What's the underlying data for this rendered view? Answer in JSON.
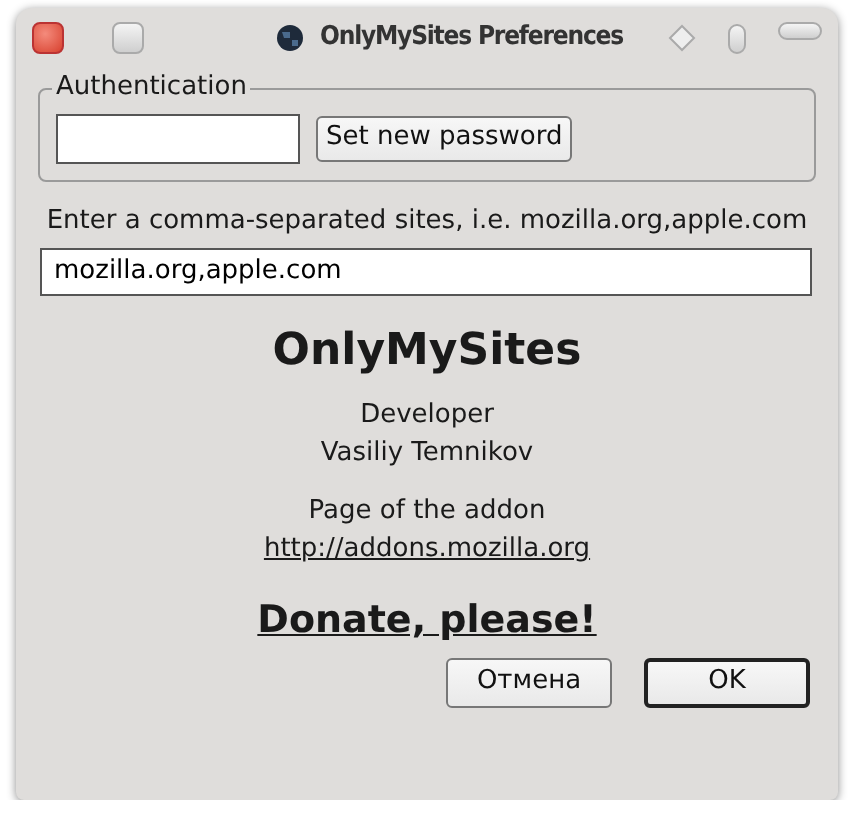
{
  "window": {
    "title": "OnlyMySites Preferences"
  },
  "authentication": {
    "legend": "Authentication",
    "button": "Set new password"
  },
  "sites": {
    "label": "Enter a comma-separated sites, i.e. mozilla.org,apple.com",
    "value": "mozilla.org,apple.com"
  },
  "about": {
    "name": "OnlyMySites",
    "developer_label": "Developer",
    "developer_name": "Vasiliy Temnikov",
    "page_label": "Page of the addon",
    "page_link": "http://addons.mozilla.org",
    "donate": "Donate, please!"
  },
  "buttons": [
    {
      "label": "Отмена",
      "default": false
    },
    {
      "label": "OK",
      "default": true
    }
  ]
}
